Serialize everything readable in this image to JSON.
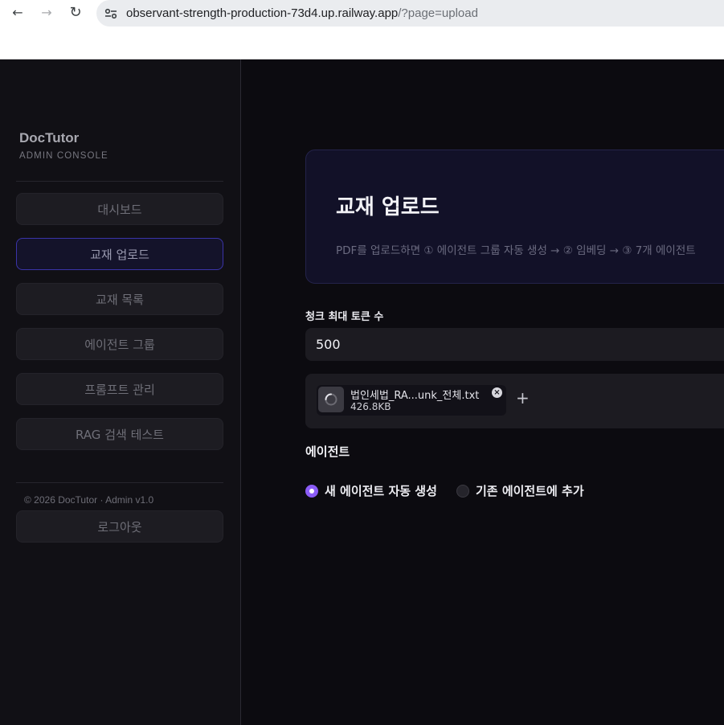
{
  "browser": {
    "url_host": "observant-strength-production-73d4.up.railway.app",
    "url_path": "/?page=upload",
    "back_glyph": "←",
    "forward_glyph": "→",
    "reload_glyph": "↻"
  },
  "sidebar": {
    "brand": "DocTutor",
    "subtitle": "ADMIN CONSOLE",
    "items": [
      {
        "label": "대시보드",
        "active": false
      },
      {
        "label": "교재 업로드",
        "active": true
      },
      {
        "label": "교재 목록",
        "active": false
      },
      {
        "label": "에이전트 그룹",
        "active": false
      },
      {
        "label": "프롬프트 관리",
        "active": false
      },
      {
        "label": "RAG 검색 테스트",
        "active": false
      }
    ],
    "copyright": "© 2026 DocTutor · Admin v1.0",
    "logout": "로그아웃"
  },
  "main": {
    "title": "교재 업로드",
    "description": "PDF를 업로드하면 ① 에이전트 그룹 자동 생성 → ② 임베딩 → ③ 7개 에이전트",
    "chunk_label": "청크 최대 토큰 수",
    "chunk_value": "500",
    "file": {
      "name": "법인세법_RA...unk_전체.txt",
      "size": "426.8KB",
      "remove_glyph": "×"
    },
    "add_glyph": "+",
    "agent_section": "에이전트",
    "radio_options": [
      {
        "label": "새 에이전트 자동 생성",
        "checked": true
      },
      {
        "label": "기존 에이전트에 추가",
        "checked": false
      }
    ]
  },
  "colors": {
    "accent": "#8b5cf6",
    "active_border": "#3a34a8",
    "background": "#0c0b10"
  }
}
